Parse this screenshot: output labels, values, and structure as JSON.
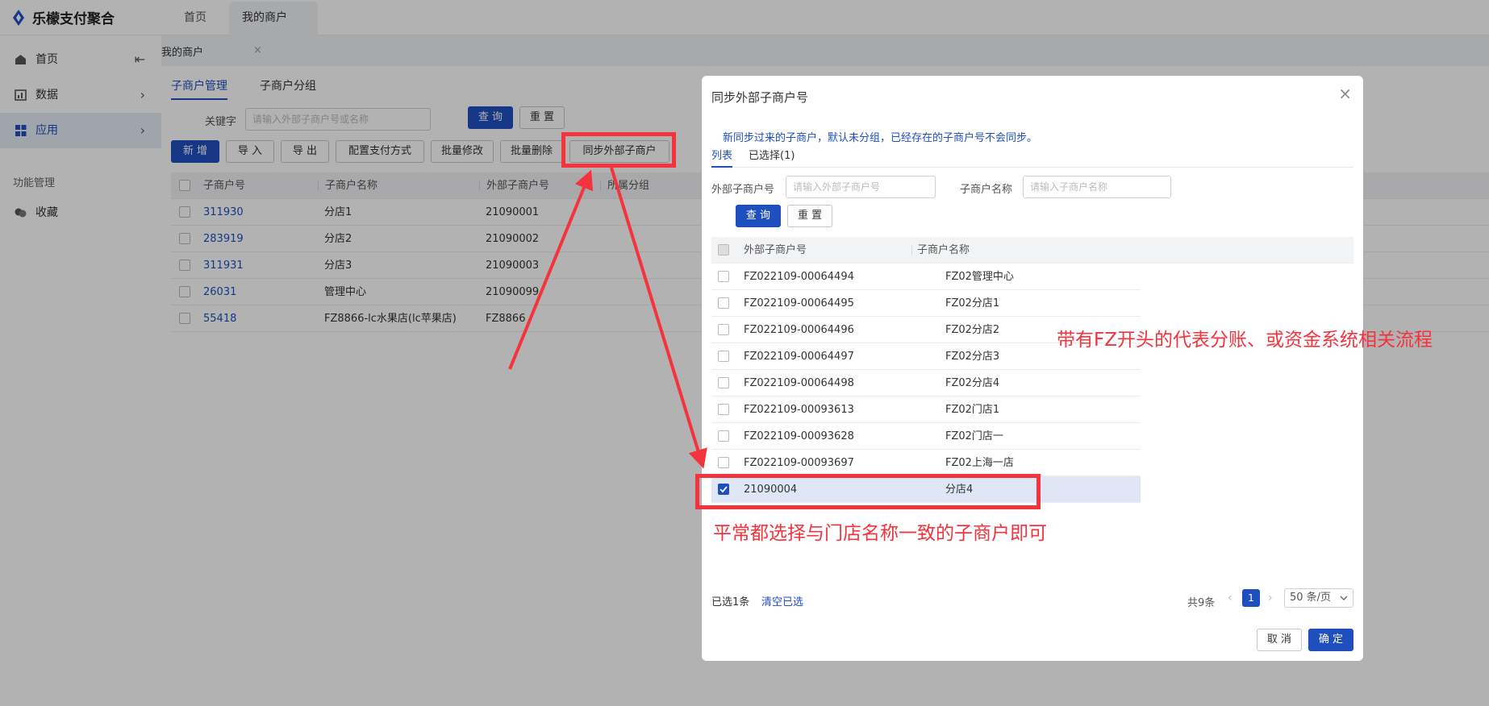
{
  "app": {
    "title": "乐檬支付聚合"
  },
  "tabs": [
    {
      "label": "首页"
    },
    {
      "label": "我的商户",
      "close": "×"
    }
  ],
  "sidebar": {
    "items": [
      {
        "label": "首页",
        "arrow": "⇤"
      },
      {
        "label": "数据",
        "arrow": "›"
      },
      {
        "label": "应用",
        "arrow": "›"
      }
    ],
    "section_title": "功能管理",
    "favorites": "收藏"
  },
  "breadcrumb": "我的商户",
  "subtabs": [
    "子商户管理",
    "子商户分组"
  ],
  "filter": {
    "keyword_label": "关键字",
    "keyword_placeholder": "请输入外部子商户号或名称",
    "query": "查 询",
    "reset": "重 置"
  },
  "toolbar": {
    "add": "新 增",
    "import": "导 入",
    "export": "导 出",
    "config_pay": "配置支付方式",
    "batch_edit": "批量修改",
    "batch_delete": "批量删除",
    "sync_external": "同步外部子商户"
  },
  "merchant_table": {
    "columns": [
      "子商户号",
      "子商户名称",
      "外部子商户号",
      "所属分组"
    ],
    "rows": [
      {
        "id": "311930",
        "name": "分店1",
        "external": "21090001"
      },
      {
        "id": "283919",
        "name": "分店2",
        "external": "21090002"
      },
      {
        "id": "311931",
        "name": "分店3",
        "external": "21090003"
      },
      {
        "id": "26031",
        "name": "管理中心",
        "external": "21090099"
      },
      {
        "id": "55418",
        "name": "FZ8866-lc水果店(lc苹果店)",
        "external": "FZ8866"
      }
    ]
  },
  "modal": {
    "title": "同步外部子商户号",
    "close": "×",
    "tip": "新同步过来的子商户，默认未分组，已经存在的子商户号不会同步。",
    "tabs": [
      "列表",
      "已选择(1)"
    ],
    "filter": {
      "external_label": "外部子商户号",
      "external_placeholder": "请输入外部子商户号",
      "name_label": "子商户名称",
      "name_placeholder": "请输入子商户名称",
      "query": "查 询",
      "reset": "重 置"
    },
    "columns": [
      "外部子商户号",
      "子商户名称"
    ],
    "rows": [
      {
        "external": "FZ022109-00064494",
        "name": "FZ02管理中心",
        "checked": false
      },
      {
        "external": "FZ022109-00064495",
        "name": "FZ02分店1",
        "checked": false
      },
      {
        "external": "FZ022109-00064496",
        "name": "FZ02分店2",
        "checked": false
      },
      {
        "external": "FZ022109-00064497",
        "name": "FZ02分店3",
        "checked": false
      },
      {
        "external": "FZ022109-00064498",
        "name": "FZ02分店4",
        "checked": false
      },
      {
        "external": "FZ022109-00093613",
        "name": "FZ02门店1",
        "checked": false
      },
      {
        "external": "FZ022109-00093628",
        "name": "FZ02门店一",
        "checked": false
      },
      {
        "external": "FZ022109-00093697",
        "name": "FZ02上海一店",
        "checked": false
      },
      {
        "external": "21090004",
        "name": "分店4",
        "checked": true
      }
    ],
    "footer": {
      "selected": "已选1条",
      "clear": "清空已选",
      "total": "共9条",
      "prev": "‹",
      "next": "›",
      "page": "1",
      "page_size": "50 条/页",
      "cancel": "取 消",
      "confirm": "确 定"
    }
  },
  "annotations": {
    "fz_note": "带有FZ开头的代表分账、或资金系统相关流程",
    "select_note": "平常都选择与门店名称一致的子商户即可",
    "color": "#f4333c"
  },
  "colors": {
    "primary": "#1f4fbf",
    "annotation": "#f4333c"
  }
}
